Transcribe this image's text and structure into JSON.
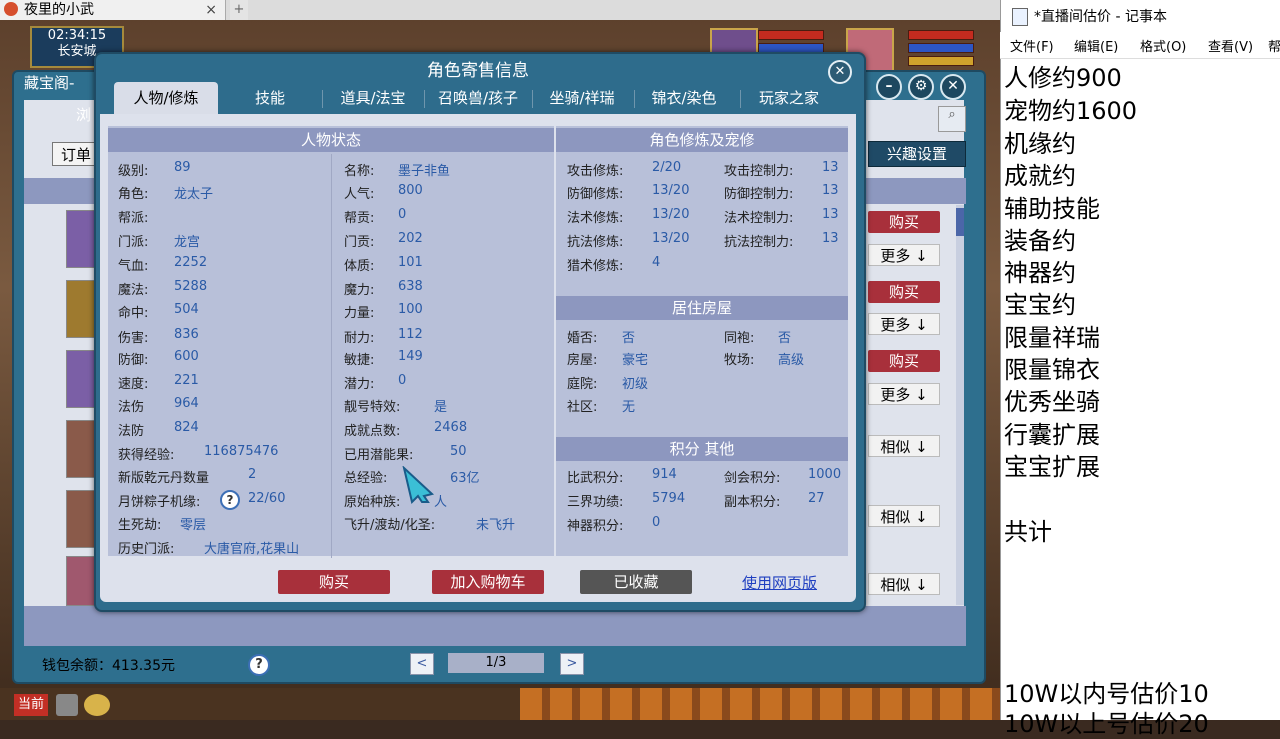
{
  "browser_tab": {
    "title": "夜里的小武",
    "close": "×",
    "plus": "+"
  },
  "game": {
    "clock_time": "02:34:15",
    "location": "长安城",
    "dang_label": "当前"
  },
  "cbg": {
    "title": "藏宝阁-",
    "nav_label": "浏",
    "order_label": "订单",
    "interest_label": "兴趣设置",
    "buy_label": "购买",
    "more_label": "更多 ↓",
    "similar_label": "相似 ↓",
    "wallet": "钱包余额：413.35元",
    "help": "?",
    "pager_prev": "<",
    "pager_next": ">",
    "pager_text": "1/3"
  },
  "modal": {
    "title": "角色寄售信息",
    "close": "✕",
    "tabs": [
      "人物/修炼",
      "技能",
      "道具/法宝",
      "召唤兽/孩子",
      "坐骑/祥瑞",
      "锦衣/染色",
      "玩家之家"
    ],
    "left_head": "人物状态",
    "right_head1": "角色修炼及宠修",
    "right_head2": "居住房屋",
    "right_head3": "积分 其他",
    "col1": [
      {
        "k": "级别:",
        "v": "89"
      },
      {
        "k": "角色:",
        "v": "龙太子"
      },
      {
        "k": "帮派:",
        "v": ""
      },
      {
        "k": "门派:",
        "v": "龙宫"
      },
      {
        "k": "气血:",
        "v": "2252"
      },
      {
        "k": "魔法:",
        "v": "5288"
      },
      {
        "k": "命中:",
        "v": "504"
      },
      {
        "k": "伤害:",
        "v": "836"
      },
      {
        "k": "防御:",
        "v": "600"
      },
      {
        "k": "速度:",
        "v": "221"
      },
      {
        "k": "法伤",
        "v": "964"
      },
      {
        "k": "法防",
        "v": "824"
      },
      {
        "k": "获得经验:",
        "v": "116875476"
      },
      {
        "k": "新版乾元丹数量",
        "v": "2"
      },
      {
        "k": "月饼粽子机缘:",
        "v": "22/60"
      },
      {
        "k": "生死劫:",
        "v": "零层"
      },
      {
        "k": "历史门派:",
        "v": "大唐官府,花果山"
      }
    ],
    "col2": [
      {
        "k": "名称:",
        "v": "墨子非鱼"
      },
      {
        "k": "人气:",
        "v": "800"
      },
      {
        "k": "帮贡:",
        "v": "0"
      },
      {
        "k": "门贡:",
        "v": "202"
      },
      {
        "k": "体质:",
        "v": "101"
      },
      {
        "k": "魔力:",
        "v": "638"
      },
      {
        "k": "力量:",
        "v": "100"
      },
      {
        "k": "耐力:",
        "v": "112"
      },
      {
        "k": "敏捷:",
        "v": "149"
      },
      {
        "k": "潜力:",
        "v": "0"
      },
      {
        "k": "靓号特效:",
        "v": "是"
      },
      {
        "k": "成就点数:",
        "v": "2468"
      },
      {
        "k": "已用潜能果:",
        "v": "50"
      },
      {
        "k": "总经验:",
        "v": "63亿"
      },
      {
        "k": "原始种族:",
        "v": "人"
      },
      {
        "k": "飞升/渡劫/化圣:",
        "v": "未飞升"
      }
    ],
    "xiu": [
      {
        "k": "攻击修炼:",
        "v": "2/20",
        "k2": "攻击控制力:",
        "v2": "13"
      },
      {
        "k": "防御修炼:",
        "v": "13/20",
        "k2": "防御控制力:",
        "v2": "13"
      },
      {
        "k": "法术修炼:",
        "v": "13/20",
        "k2": "法术控制力:",
        "v2": "13"
      },
      {
        "k": "抗法修炼:",
        "v": "13/20",
        "k2": "抗法控制力:",
        "v2": "13"
      },
      {
        "k": "猎术修炼:",
        "v": "4",
        "k2": "",
        "v2": ""
      }
    ],
    "house": [
      {
        "k": "婚否:",
        "v": "否",
        "k2": "同袍:",
        "v2": "否"
      },
      {
        "k": "房屋:",
        "v": "豪宅",
        "k2": "牧场:",
        "v2": "高级"
      },
      {
        "k": "庭院:",
        "v": "初级",
        "k2": "",
        "v2": ""
      },
      {
        "k": "社区:",
        "v": "无",
        "k2": "",
        "v2": ""
      }
    ],
    "score": [
      {
        "k": "比武积分:",
        "v": "914",
        "k2": "剑会积分:",
        "v2": "1000"
      },
      {
        "k": "三界功绩:",
        "v": "5794",
        "k2": "副本积分:",
        "v2": "27"
      },
      {
        "k": "神器积分:",
        "v": "0",
        "k2": "",
        "v2": ""
      }
    ],
    "btn_buy": "购买",
    "btn_cart": "加入购物车",
    "btn_fav": "已收藏",
    "link_web": "使用网页版"
  },
  "notepad": {
    "title": "*直播间估价 - 记事本",
    "menu": [
      "文件(F)",
      "编辑(E)",
      "格式(O)",
      "查看(V)",
      "帮"
    ],
    "lines": [
      "人修约900",
      "宠物约1600",
      "机缘约",
      "成就约",
      "辅助技能",
      "装备约",
      "神器约",
      "宝宝约",
      "限量祥瑞",
      "限量锦衣",
      "优秀坐骑",
      "行囊扩展",
      "宝宝扩展",
      "",
      "共计"
    ],
    "footer_lines": [
      "10W以内号估价10",
      "10W以上号估价20"
    ]
  },
  "colors": {
    "accent_blue": "#2e6c8c",
    "buy_red": "#a8303b",
    "value_blue": "#2a5aa6"
  }
}
